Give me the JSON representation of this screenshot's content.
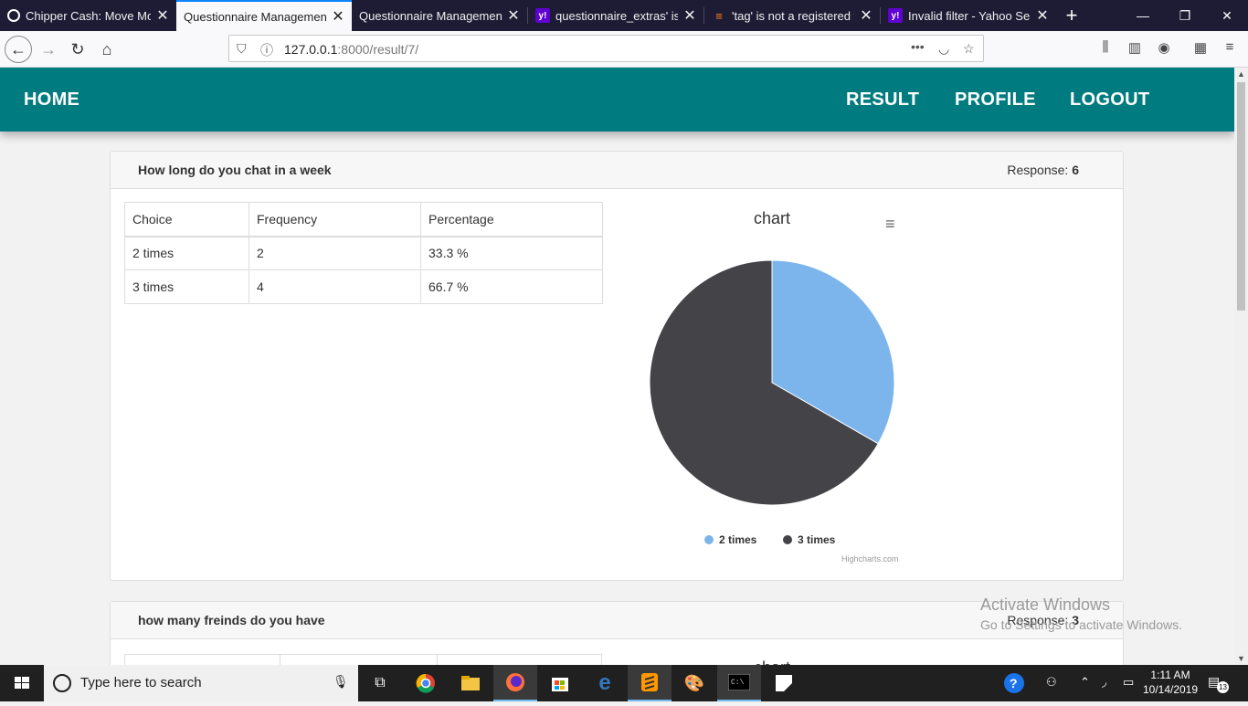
{
  "browser": {
    "tabs": [
      {
        "title": "Chipper Cash: Move Mor",
        "icon": "chipper-icon"
      },
      {
        "title": "Questionnaire Management",
        "icon": "none",
        "active": true
      },
      {
        "title": "Questionnaire Management",
        "icon": "none"
      },
      {
        "title": "questionnaire_extras' is n",
        "icon": "yahoo-icon"
      },
      {
        "title": "'tag' is not a registered ta",
        "icon": "stackoverflow-icon"
      },
      {
        "title": "Invalid filter - Yahoo Sear",
        "icon": "yahoo-icon"
      }
    ],
    "url_host": "127.0.0.1",
    "url_rest": ":8000/result/7/",
    "url_dots": "•••"
  },
  "nav": {
    "home": "HOME",
    "result": "RESULT",
    "profile": "PROFILE",
    "logout": "LOGOUT"
  },
  "question1": {
    "title": "How long do you chat in a week",
    "response_label": "Response:",
    "response_count": "6",
    "table_headers": [
      "Choice",
      "Frequency",
      "Percentage"
    ],
    "rows": [
      {
        "choice": "2 times",
        "frequency": "2",
        "percentage": "33.3 %"
      },
      {
        "choice": "3 times",
        "frequency": "4",
        "percentage": "66.7 %"
      }
    ],
    "chart_title": "chart",
    "credit": "Highcharts.com"
  },
  "question2": {
    "title": "how many freinds do you have",
    "response_label": "Response:",
    "response_count": "3",
    "chart_title": "chart"
  },
  "chart_data": {
    "type": "pie",
    "title": "chart",
    "categories": [
      "2 times",
      "3 times"
    ],
    "values": [
      33.3,
      66.7
    ],
    "colors": [
      "#7cb5ec",
      "#434348"
    ],
    "legend": "bottom"
  },
  "watermark": {
    "line1": "Activate Windows",
    "line2": "Go to Settings to activate Windows."
  },
  "taskbar": {
    "search_placeholder": "Type here to search",
    "time": "1:11 AM",
    "date": "10/14/2019",
    "notifications": "13"
  }
}
